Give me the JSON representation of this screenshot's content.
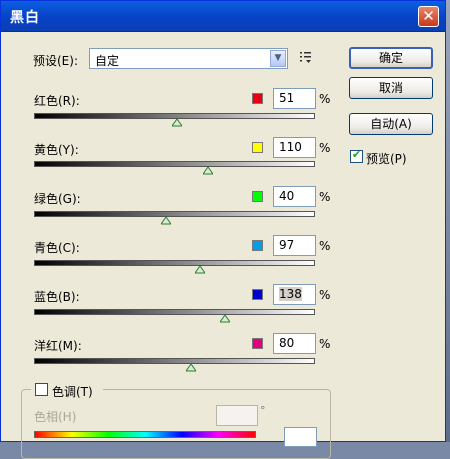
{
  "title": "黑白",
  "preset": {
    "label": "预设(E):",
    "value": "自定"
  },
  "buttons": {
    "ok": "确定",
    "cancel": "取消",
    "auto": "自动(A)"
  },
  "preview": {
    "label": "预览(P)",
    "checked": true
  },
  "percent_sign": "%",
  "sliders": [
    {
      "label": "红色(R):",
      "value": "51",
      "color": "#e60012",
      "level": 0.51
    },
    {
      "label": "黄色(Y):",
      "value": "110",
      "color": "#ffff00",
      "level": 0.62
    },
    {
      "label": "绿色(G):",
      "value": "40",
      "color": "#00ff00",
      "level": 0.47
    },
    {
      "label": "青色(C):",
      "value": "97",
      "color": "#00a0e9",
      "level": 0.59
    },
    {
      "label": "蓝色(B):",
      "value": "138",
      "color": "#0000cc",
      "level": 0.68
    },
    {
      "label": "洋红(M):",
      "value": "80",
      "color": "#e4007f",
      "level": 0.56
    }
  ],
  "tint": {
    "label": "色调(T)",
    "hue_label": "色相(H)",
    "degree": "°",
    "checked": false
  }
}
